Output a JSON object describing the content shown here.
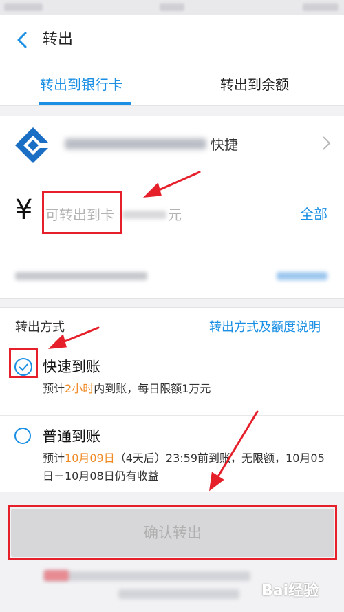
{
  "nav": {
    "title": "转出"
  },
  "tabs": [
    {
      "label": "转出到银行卡",
      "active": true
    },
    {
      "label": "转出到余额",
      "active": false
    }
  ],
  "bank": {
    "tag": "快捷",
    "logo_color": "#1a6fc4"
  },
  "amount": {
    "currency_symbol": "¥",
    "placeholder_prefix": "可转出到卡",
    "unit": "元",
    "all_label": "全部"
  },
  "method": {
    "label": "转出方式",
    "help_link": "转出方式及额度说明",
    "options": [
      {
        "title": "快速到账",
        "desc_before": "预计",
        "desc_highlight": "2小时",
        "desc_after": "内到账，每日限额1万元",
        "selected": true
      },
      {
        "title": "普通到账",
        "desc_before": "预计",
        "desc_highlight": "10月09日",
        "desc_after": "（4天后）23:59前到账，无限额，10月05",
        "desc_line2": "日－10月08日仍有收益",
        "selected": false
      }
    ]
  },
  "confirm_label": "确认转出",
  "watermark": "Bai经验",
  "colors": {
    "accent": "#1a8fe3",
    "annotation": "#e5202a",
    "highlight": "#f08a24",
    "button_disabled": "#d7d7d9"
  }
}
